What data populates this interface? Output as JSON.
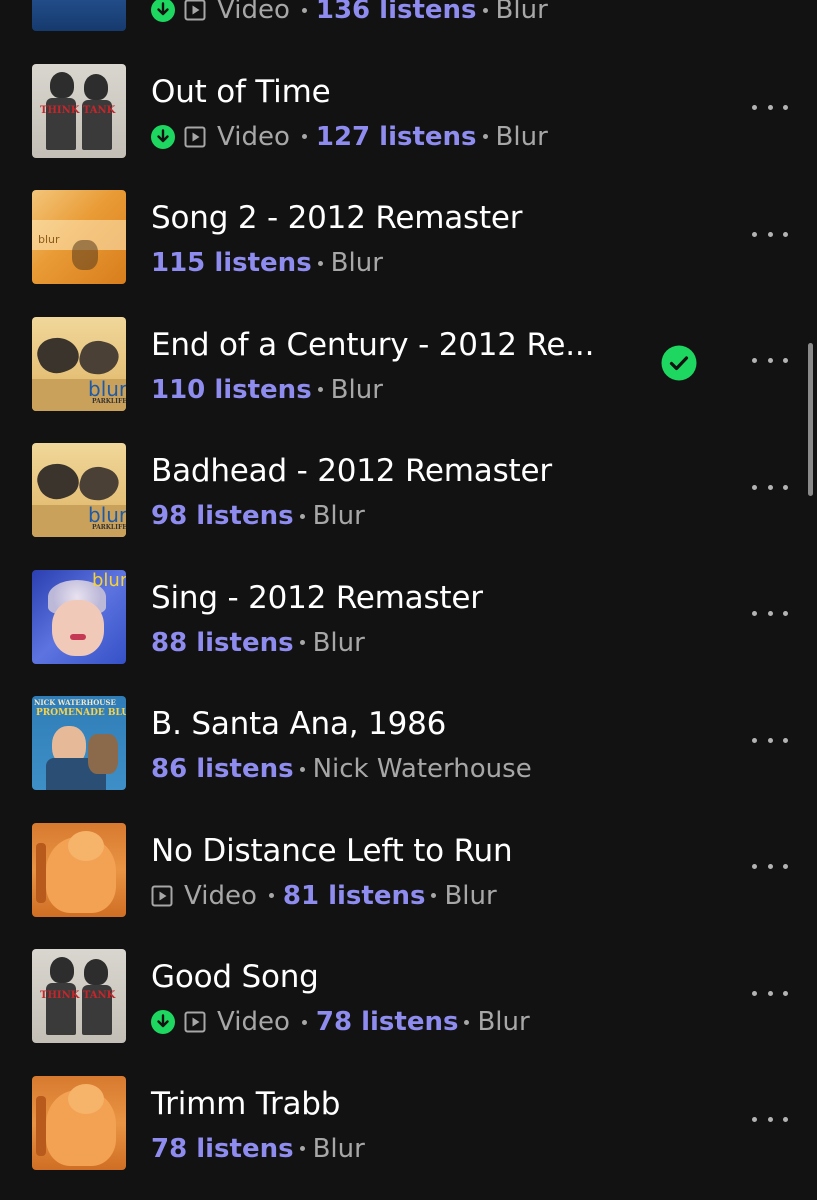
{
  "colors": {
    "background": "#121212",
    "listens": "#8f8cf0",
    "secondary_text": "#a7a7a7",
    "download_green": "#1ed760",
    "saved_green": "#1ed760"
  },
  "icons": {
    "download": "download-icon",
    "video": "video-icon",
    "saved": "check-circle-icon",
    "more": "more-options-icon"
  },
  "tracks": [
    {
      "title": "",
      "artwork": "ship-photo",
      "downloaded": true,
      "type_label": "Video",
      "listens": "136 listens",
      "artist": "Blur",
      "saved": false
    },
    {
      "title": "Out of Time",
      "artwork": "think-tank",
      "artwork_text": "THINK TANK",
      "downloaded": true,
      "type_label": "Video",
      "listens": "127 listens",
      "artist": "Blur",
      "saved": false
    },
    {
      "title": "Song 2 - 2012 Remaster",
      "artwork": "blur-orange",
      "artwork_text": "blur",
      "downloaded": false,
      "type_label": "",
      "listens": "115 listens",
      "artist": "Blur",
      "saved": false
    },
    {
      "title": "End of a Century - 2012 Re...",
      "artwork": "parklife",
      "artwork_text": "blur",
      "artwork_subtext": "PARKLIFE",
      "downloaded": false,
      "type_label": "",
      "listens": "110 listens",
      "artist": "Blur",
      "saved": true
    },
    {
      "title": "Badhead - 2012 Remaster",
      "artwork": "parklife",
      "artwork_text": "blur",
      "artwork_subtext": "PARKLIFE",
      "downloaded": false,
      "type_label": "",
      "listens": "98 listens",
      "artist": "Blur",
      "saved": false
    },
    {
      "title": "Sing - 2012 Remaster",
      "artwork": "leisure",
      "artwork_text": "blur",
      "downloaded": false,
      "type_label": "",
      "listens": "88 listens",
      "artist": "Blur",
      "saved": false
    },
    {
      "title": "B. Santa Ana, 1986",
      "artwork": "promenade-blue",
      "artwork_text": "NICK WATERHOUSE",
      "artwork_subtext": "PROMENADE BLUE",
      "downloaded": false,
      "type_label": "",
      "listens": "86 listens",
      "artist": "Nick Waterhouse",
      "saved": false
    },
    {
      "title": "No Distance Left to Run",
      "artwork": "blur-13",
      "downloaded": false,
      "type_label": "Video",
      "listens": "81 listens",
      "artist": "Blur",
      "saved": false
    },
    {
      "title": "Good Song",
      "artwork": "think-tank",
      "artwork_text": "THINK TANK",
      "downloaded": true,
      "type_label": "Video",
      "listens": "78 listens",
      "artist": "Blur",
      "saved": false
    },
    {
      "title": "Trimm Trabb",
      "artwork": "blur-13",
      "downloaded": false,
      "type_label": "",
      "listens": "78 listens",
      "artist": "Blur",
      "saved": false
    }
  ]
}
